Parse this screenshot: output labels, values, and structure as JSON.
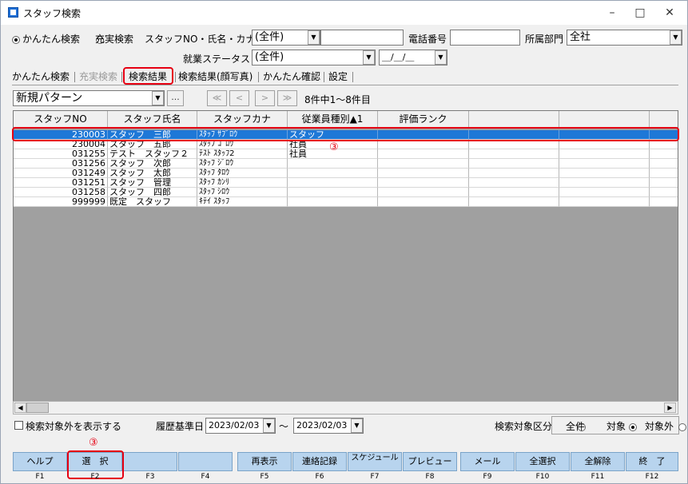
{
  "window": {
    "title": "スタッフ検索",
    "min": "–",
    "max": "□",
    "close": "✕"
  },
  "search": {
    "mode_easy": "かんたん検索",
    "mode_full": "充実検索",
    "staff_label": "スタッフNO・氏名・カナ",
    "staff_select": "(全件)",
    "staff_text": "",
    "phone_label": "電話番号",
    "phone_value": "",
    "dept_label": "所属部門",
    "dept_value": "全社",
    "status_label": "就業ステータス",
    "status_value": "(全件)",
    "date_value": "＿/＿/＿"
  },
  "tabs": [
    {
      "label": "かんたん検索"
    },
    {
      "label": "充実検索"
    },
    {
      "label": "検索結果"
    },
    {
      "label": "検索結果(顔写真)"
    },
    {
      "label": "かんたん確認"
    },
    {
      "label": "設定"
    }
  ],
  "toolbar": {
    "pattern": "新規パターン",
    "more": "...",
    "first": "≪",
    "prev": "<",
    "next": ">",
    "last": "≫",
    "count": "8件中1～8件目"
  },
  "grid": {
    "columns": [
      "スタッフNO",
      "スタッフ氏名",
      "スタッフカナ",
      "従業員種別▲1",
      "評価ランク",
      "",
      "",
      ""
    ],
    "rows": [
      {
        "no": "230003",
        "name": "スタッフ　三郎",
        "kana": "ｽﾀｯﾌ ｻﾌﾞﾛｳ",
        "type": "スタッフ"
      },
      {
        "no": "230004",
        "name": "スタッフ　五郎",
        "kana": "ｽﾀｯﾌ ｺﾞﾛｳ",
        "type": "社員"
      },
      {
        "no": "031255",
        "name": "テスト　スタッフ２",
        "kana": "ﾃｽﾄ ｽﾀｯﾌ2",
        "type": "社員"
      },
      {
        "no": "031256",
        "name": "スタッフ　次郎",
        "kana": "ｽﾀｯﾌ ｼﾞﾛｳ",
        "type": ""
      },
      {
        "no": "031249",
        "name": "スタッフ　太郎",
        "kana": "ｽﾀｯﾌ ﾀﾛｳ",
        "type": ""
      },
      {
        "no": "031251",
        "name": "スタッフ　管理",
        "kana": "ｽﾀｯﾌ ｶﾝﾘ",
        "type": ""
      },
      {
        "no": "031258",
        "name": "スタッフ　四郎",
        "kana": "ｽﾀｯﾌ ｼﾛｳ",
        "type": ""
      },
      {
        "no": "999999",
        "name": "既定　スタッフ",
        "kana": "ｷﾃｲ ｽﾀｯﾌ",
        "type": ""
      }
    ]
  },
  "bottom": {
    "show_excluded": "検索対象外を表示する",
    "history_label": "履歴基準日",
    "date_from": "2023/02/03",
    "tilde": "～",
    "date_to": "2023/02/03",
    "target_label": "検索対象区分",
    "opt_all": "全件",
    "opt_target": "対象",
    "opt_excluded": "対象外"
  },
  "fkeys": [
    {
      "label": "ヘルプ",
      "key": "F1"
    },
    {
      "label": "選　択",
      "key": "F2"
    },
    {
      "label": "",
      "key": "F3"
    },
    {
      "label": "",
      "key": "F4"
    },
    {
      "label": "再表示",
      "key": "F5"
    },
    {
      "label": "連絡記録",
      "key": "F6"
    },
    {
      "label": "スケジュール",
      "key": "F7"
    },
    {
      "label": "プレビュー",
      "key": "F8"
    },
    {
      "label": "メール",
      "key": "F9"
    },
    {
      "label": "全選択",
      "key": "F10"
    },
    {
      "label": "全解除",
      "key": "F11"
    },
    {
      "label": "終　了",
      "key": "F12"
    }
  ],
  "annotations": {
    "marker": "③"
  },
  "colors": {
    "selection": "#1e78d7",
    "highlight": "#e60012",
    "fkey_bg": "#b8d4ee"
  }
}
